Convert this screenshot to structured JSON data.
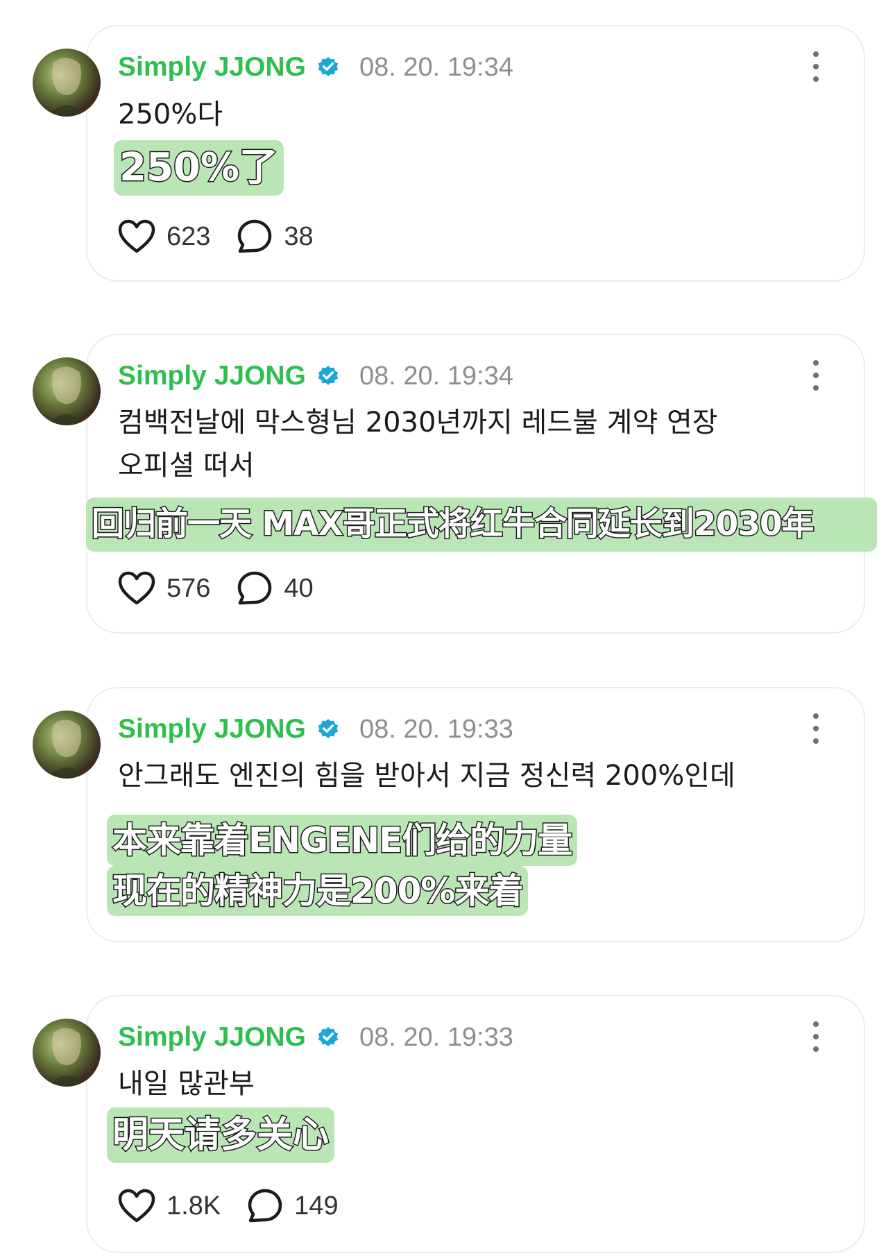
{
  "colors": {
    "username": "#2fbf4f",
    "verified": "#1aa9d6",
    "translation_bg": "#b9e6b4",
    "timestamp": "#8e8e8e"
  },
  "icons": {
    "like": "heart-icon",
    "comment": "speech-bubble-icon",
    "verified": "verified-badge-icon",
    "more": "more-vertical-icon"
  },
  "posts": [
    {
      "username": "Simply JJONG",
      "timestamp": "08. 20. 19:34",
      "text": "250%다",
      "translation": [
        "250%了"
      ],
      "likes": "623",
      "comments": "38"
    },
    {
      "username": "Simply JJONG",
      "timestamp": "08. 20. 19:34",
      "text": "컴백전날에 막스형님 2030년까지 레드불 계약 연장\n오피셜 떠서",
      "translation": [
        "回归前一天 MAX哥正式将红牛合同延长到2030年"
      ],
      "likes": "576",
      "comments": "40"
    },
    {
      "username": "Simply JJONG",
      "timestamp": "08. 20. 19:33",
      "text": "안그래도 엔진의 힘을 받아서 지금 정신력 200%인데",
      "translation": [
        "本来靠着ENGENE们给的力量",
        "现在的精神力是200%来着"
      ],
      "likes": "",
      "comments": ""
    },
    {
      "username": "Simply JJONG",
      "timestamp": "08. 20. 19:33",
      "text": "내일 많관부",
      "translation": [
        "明天请多关心"
      ],
      "likes": "1.8K",
      "comments": "149"
    }
  ]
}
